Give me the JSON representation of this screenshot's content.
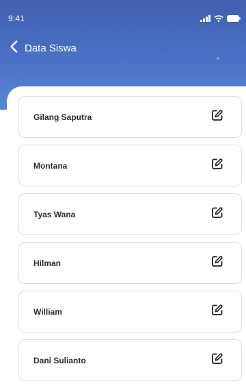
{
  "status_bar": {
    "time": "9:41"
  },
  "header": {
    "title": "Data Siswa",
    "back_icon": "chevron-left-icon"
  },
  "colors": {
    "header_top": "#3e5fae",
    "header_bottom": "#5b87d6",
    "card_border": "#dcdfe6",
    "text": "#2b2b2b"
  },
  "students": [
    {
      "name": "Gilang Saputra",
      "action_icon": "edit-icon"
    },
    {
      "name": "Montana",
      "action_icon": "edit-icon"
    },
    {
      "name": "Tyas Wana",
      "action_icon": "edit-icon"
    },
    {
      "name": "Hilman",
      "action_icon": "edit-icon"
    },
    {
      "name": "William",
      "action_icon": "edit-icon"
    },
    {
      "name": "Dani Sulianto",
      "action_icon": "edit-icon"
    }
  ]
}
